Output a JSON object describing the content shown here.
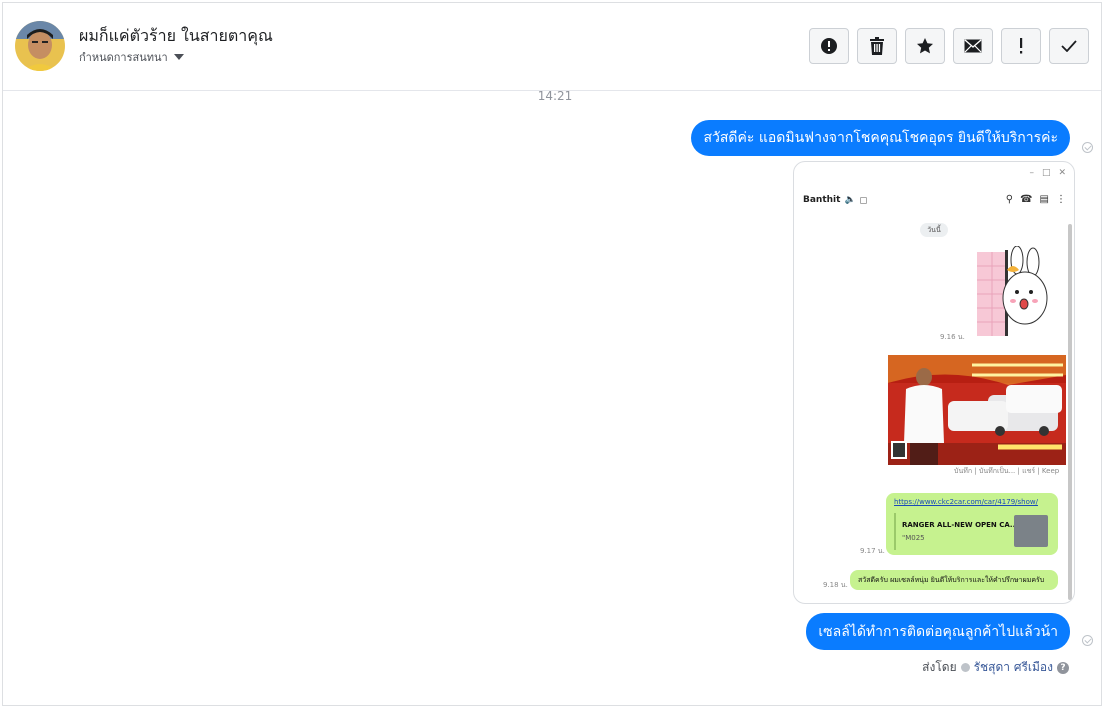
{
  "header": {
    "contact_name": "ผมก็แค่ตัวร้าย ในสายตาคุณ",
    "conversation_label": "กำหนดการสนทนา",
    "actions": [
      {
        "name": "alert-button",
        "icon": "exclamation-circle-icon"
      },
      {
        "name": "delete-button",
        "icon": "trash-icon"
      },
      {
        "name": "star-button",
        "icon": "star-icon"
      },
      {
        "name": "mail-button",
        "icon": "envelope-icon"
      },
      {
        "name": "important-button",
        "icon": "exclamation-icon"
      },
      {
        "name": "done-button",
        "icon": "checkmark-icon"
      }
    ]
  },
  "conversation": {
    "timestamp": "14:21",
    "message_1": "สวัสดีค่ะ แอดมินฟางจากโชคคุณโชคอุดร ยินดีให้บริการค่ะ",
    "message_2": "เซลล์ได้ทำการติดต่อคุณลูกค้าไปแล้วน้า",
    "sent_by_label": "ส่งโดย",
    "sent_by_name": "รัชสุดา ศรีเมือง",
    "help_icon": "question-circle-icon"
  },
  "attachment": {
    "contact_name": "Banthit",
    "today_label": "วันนี้",
    "sticker_time": "9.16 น.",
    "promo_caption": "บันทึก | บันทึกเป็น... | แชร์ | Keep",
    "link_url": "https://www.ckc2car.com/car/4179/show/",
    "link_title": "RANGER ALL-NEW OPEN CA...",
    "link_sub": "\"M025",
    "link_time": "9.17 น.",
    "greeting_text": "สวัสดีครับ ผมเซลล์หนุ่ม ยินดีให้บริการและให้คำปรึกษาผมครับ",
    "greeting_time": "9.18 น."
  },
  "colors": {
    "bubble_blue": "#0a7cff",
    "line_green": "#c6f28f"
  }
}
